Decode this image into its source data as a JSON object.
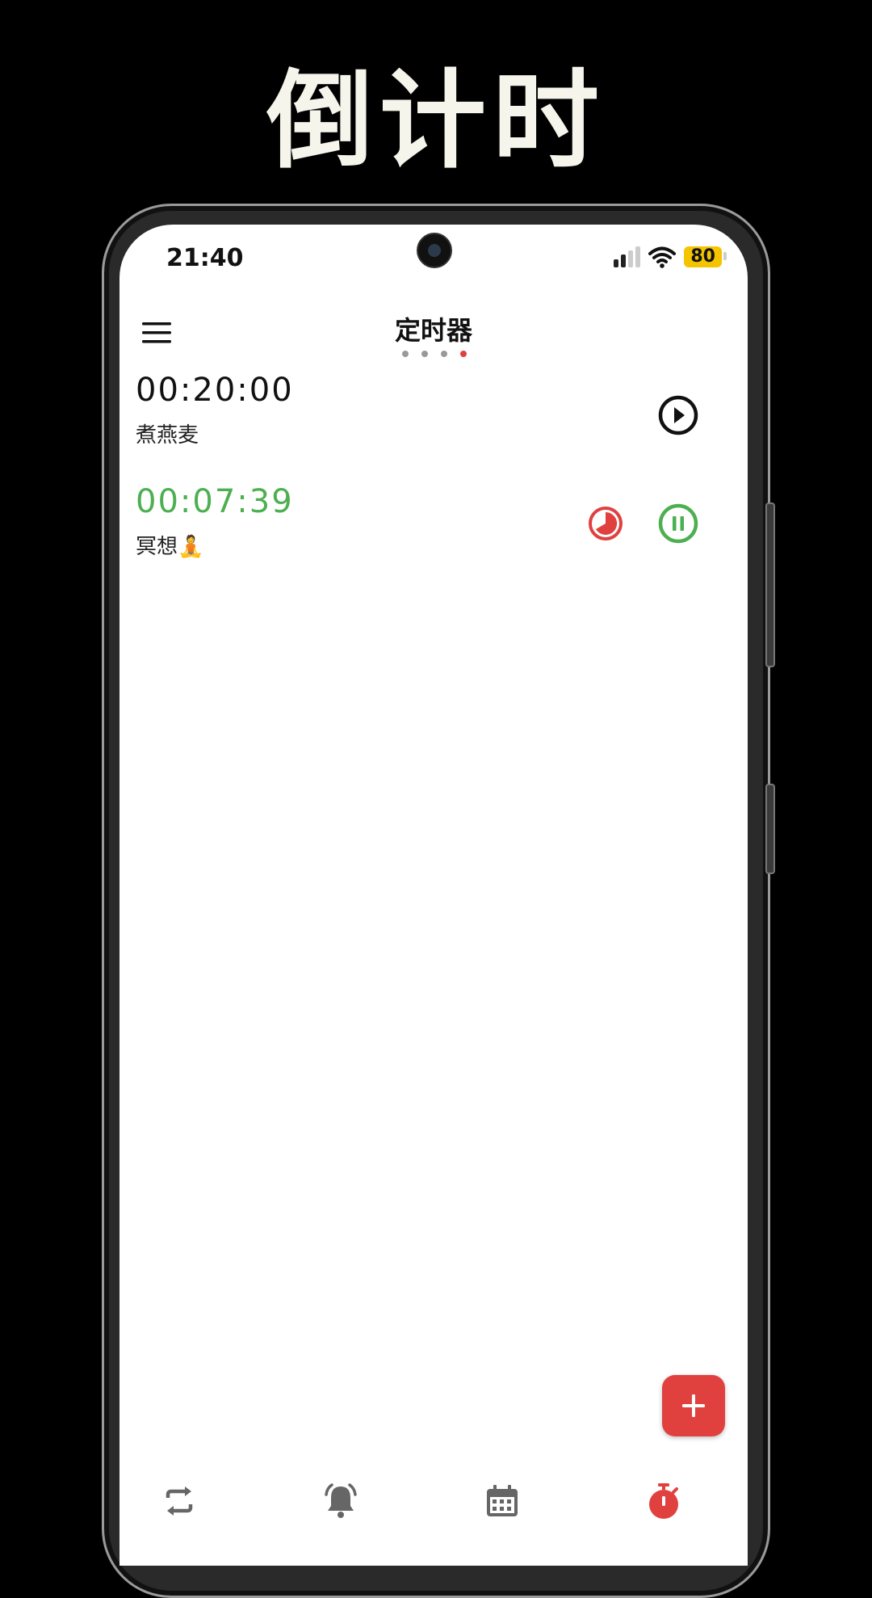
{
  "promo": {
    "title": "倒计时"
  },
  "status_bar": {
    "time": "21:40",
    "battery": "80"
  },
  "header": {
    "title": "定时器",
    "page_count": 4,
    "active_page": 3
  },
  "timers": [
    {
      "time": "00:20:00",
      "label": "煮燕麦",
      "state": "stopped"
    },
    {
      "time": "00:07:39",
      "label": "冥想🧘",
      "state": "running"
    }
  ],
  "colors": {
    "accent": "#e0413f",
    "running": "#4caf50",
    "icon_gray": "#666666",
    "battery": "#f5c400"
  },
  "icons": {
    "menu": "hamburger-icon",
    "play": "play-circle-icon",
    "pause": "pause-circle-icon",
    "progress": "progress-ring-icon",
    "add": "plus-icon",
    "nav": [
      "repeat-icon",
      "alarm-bell-icon",
      "calendar-icon",
      "stopwatch-icon"
    ]
  }
}
